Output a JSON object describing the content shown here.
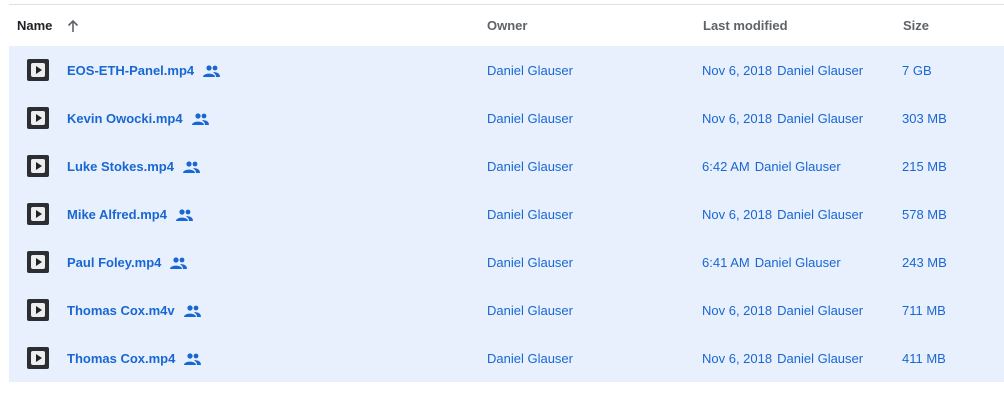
{
  "header": {
    "name": "Name",
    "owner": "Owner",
    "last_modified": "Last modified",
    "size": "Size",
    "sort_icon": "arrow-up-icon"
  },
  "colors": {
    "selected_row_bg": "#e8f0fe",
    "link_text": "#1967d2",
    "header_text": "#5f6368"
  },
  "files": [
    {
      "name": "EOS-ETH-Panel.mp4",
      "owner": "Daniel Glauser",
      "modified": "Nov 6, 2018",
      "modified_by": "Daniel Glauser",
      "size": "7 GB",
      "icon": "video-thumbnail-icon",
      "shared_icon": "shared-users-icon"
    },
    {
      "name": "Kevin Owocki.mp4",
      "owner": "Daniel Glauser",
      "modified": "Nov 6, 2018",
      "modified_by": "Daniel Glauser",
      "size": "303 MB",
      "icon": "video-thumbnail-icon",
      "shared_icon": "shared-users-icon"
    },
    {
      "name": "Luke Stokes.mp4",
      "owner": "Daniel Glauser",
      "modified": "6:42 AM",
      "modified_by": "Daniel Glauser",
      "size": "215 MB",
      "icon": "video-thumbnail-icon",
      "shared_icon": "shared-users-icon"
    },
    {
      "name": "Mike Alfred.mp4",
      "owner": "Daniel Glauser",
      "modified": "Nov 6, 2018",
      "modified_by": "Daniel Glauser",
      "size": "578 MB",
      "icon": "video-thumbnail-icon",
      "shared_icon": "shared-users-icon"
    },
    {
      "name": "Paul Foley.mp4",
      "owner": "Daniel Glauser",
      "modified": "6:41 AM",
      "modified_by": "Daniel Glauser",
      "size": "243 MB",
      "icon": "video-thumbnail-icon",
      "shared_icon": "shared-users-icon"
    },
    {
      "name": "Thomas Cox.m4v",
      "owner": "Daniel Glauser",
      "modified": "Nov 6, 2018",
      "modified_by": "Daniel Glauser",
      "size": "711 MB",
      "icon": "video-thumbnail-icon",
      "shared_icon": "shared-users-icon"
    },
    {
      "name": "Thomas Cox.mp4",
      "owner": "Daniel Glauser",
      "modified": "Nov 6, 2018",
      "modified_by": "Daniel Glauser",
      "size": "411 MB",
      "icon": "video-thumbnail-icon",
      "shared_icon": "shared-users-icon"
    }
  ]
}
